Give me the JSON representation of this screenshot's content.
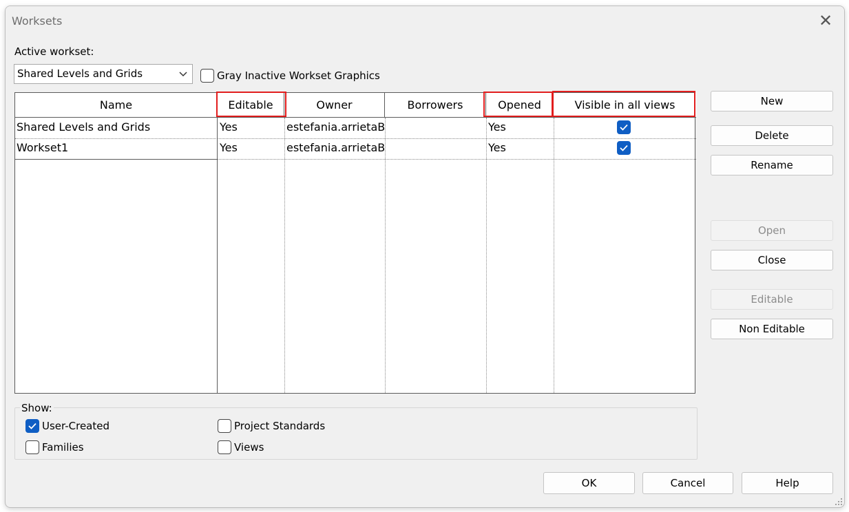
{
  "window": {
    "title": "Worksets"
  },
  "active_workset": {
    "label": "Active workset:",
    "value": "Shared Levels and Grids",
    "gray_inactive_label": "Gray Inactive Workset Graphics",
    "gray_inactive_checked": false
  },
  "table": {
    "columns": [
      "Name",
      "Editable",
      "Owner",
      "Borrowers",
      "Opened",
      "Visible in all views"
    ],
    "rows": [
      {
        "name": "Shared Levels and Grids",
        "editable": "Yes",
        "owner": "estefania.arrietaBS",
        "borrowers": "",
        "opened": "Yes",
        "visible": true
      },
      {
        "name": "Workset1",
        "editable": "Yes",
        "owner": "estefania.arrietaBS",
        "borrowers": "",
        "opened": "Yes",
        "visible": true
      }
    ]
  },
  "side_buttons": {
    "new": "New",
    "delete": "Delete",
    "rename": "Rename",
    "open": "Open",
    "close": "Close",
    "editable": "Editable",
    "non_editable": "Non Editable"
  },
  "show": {
    "label": "Show:",
    "user_created": {
      "label": "User-Created",
      "checked": true
    },
    "families": {
      "label": "Families",
      "checked": false
    },
    "project_standards": {
      "label": "Project Standards",
      "checked": false
    },
    "views": {
      "label": "Views",
      "checked": false
    }
  },
  "footer": {
    "ok": "OK",
    "cancel": "Cancel",
    "help": "Help"
  },
  "colors": {
    "accent": "#0f5ec4",
    "highlight": "#e21d1d",
    "disabled_text": "#8c8c8c"
  }
}
